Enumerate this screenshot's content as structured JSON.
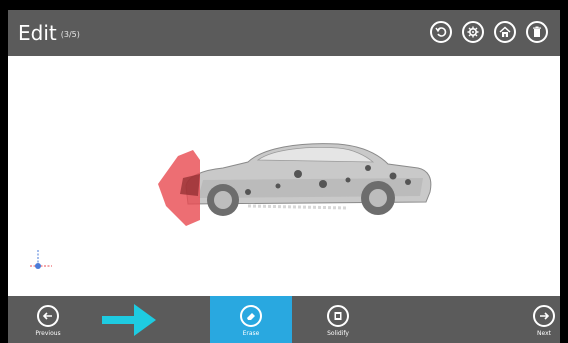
{
  "header": {
    "title": "Edit",
    "step": "(3/5)",
    "icons": [
      "undo-icon",
      "settings-icon",
      "home-icon",
      "delete-icon"
    ]
  },
  "toolbar": {
    "previous_label": "Previous",
    "erase_label": "Erase",
    "solidify_label": "Solidify",
    "next_label": "Next"
  },
  "colors": {
    "bar": "#5b5b5b",
    "accent": "#29a8e0",
    "arrow": "#1ecbe1",
    "selection": "#e84a50"
  }
}
